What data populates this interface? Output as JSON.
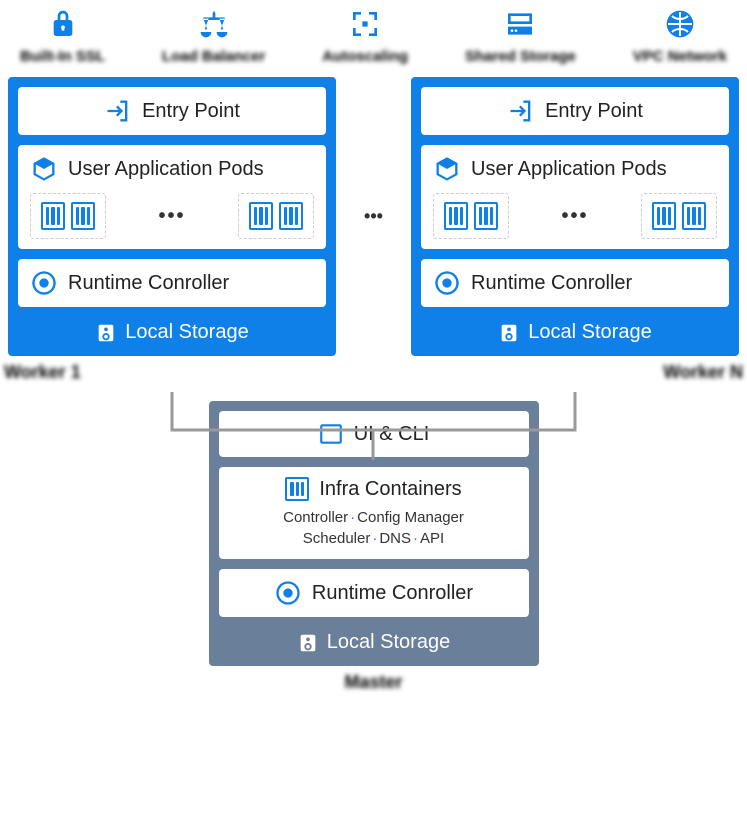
{
  "top": [
    {
      "label": "Built-In SSL"
    },
    {
      "label": "Load Balancer"
    },
    {
      "label": "Autoscaling"
    },
    {
      "label": "Shared Storage"
    },
    {
      "label": "VPC Network"
    }
  ],
  "worker": {
    "entry": "Entry Point",
    "pods": "User Application Pods",
    "runtime": "Runtime Conroller",
    "storage": "Local Storage",
    "label_left": "Worker 1",
    "label_right": "Worker N",
    "dots": "•••",
    "between": "•••"
  },
  "master": {
    "ui": "UI & CLI",
    "infra": "Infra Containers",
    "infra_items": [
      "Controller",
      "Config Manager",
      "Scheduler",
      "DNS",
      "API"
    ],
    "runtime": "Runtime Conroller",
    "storage": "Local Storage",
    "label": "Master"
  }
}
